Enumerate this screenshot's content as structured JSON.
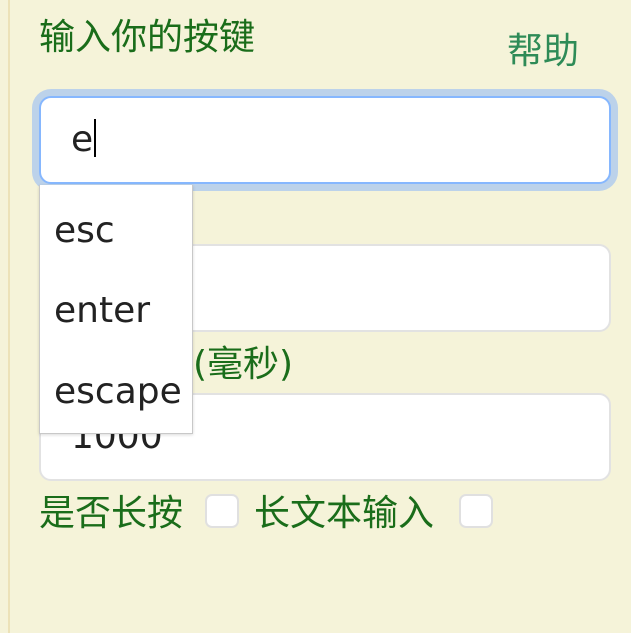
{
  "form": {
    "key_label": "输入你的按键",
    "help_link": "帮助",
    "key_input_value": "e",
    "second_input_value": "",
    "delay_label_visible": "(毫秒)",
    "delay_input_value": "1000",
    "long_press_label": "是否长按",
    "long_press_checked": false,
    "long_text_label": "长文本输入",
    "long_text_checked": false
  },
  "autocomplete": {
    "options": [
      "esc",
      "enter",
      "escape"
    ]
  },
  "colors": {
    "background": "#f5f3d9",
    "label_text": "#1a6d1a",
    "help_link": "#2e8b57",
    "focus_ring": "#bcd2ea",
    "focus_border": "#86b7fe"
  }
}
